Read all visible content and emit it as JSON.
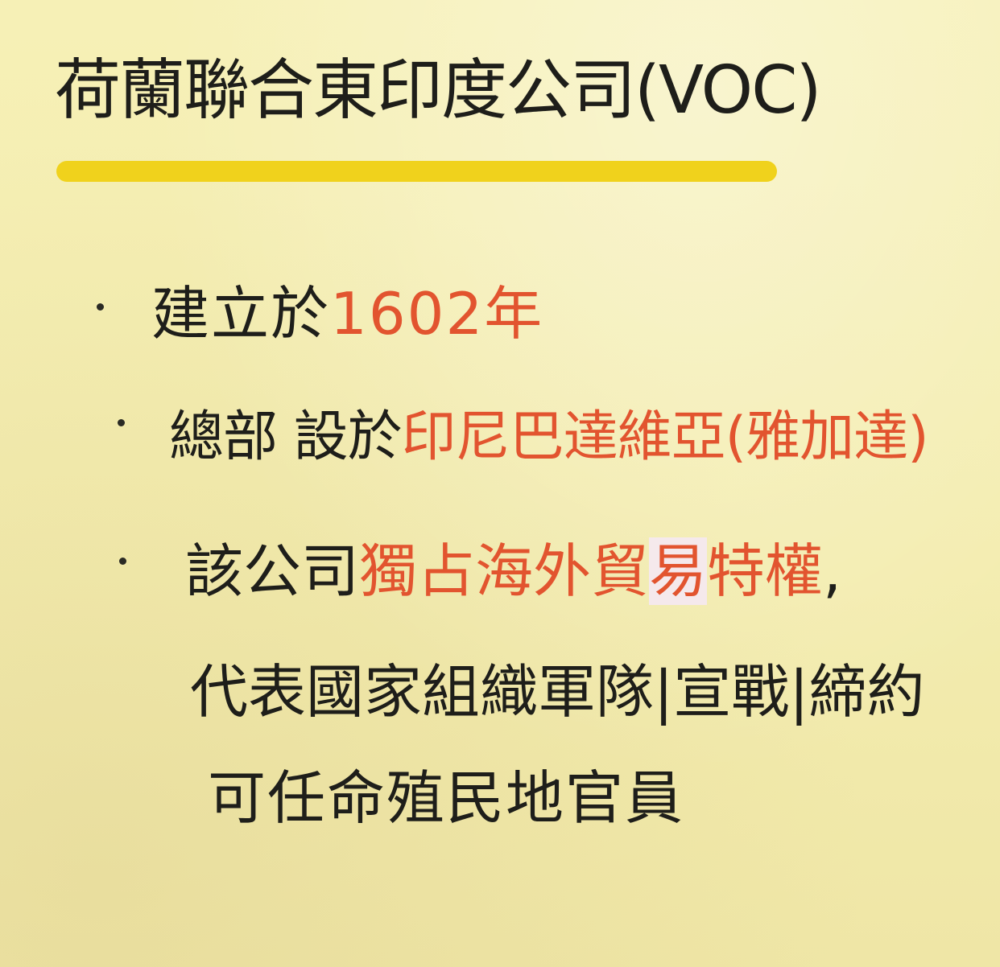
{
  "title": "荷蘭聯合東印度公司(VOC)",
  "colors": {
    "ink": "#1e1e1a",
    "highlight": "#e2542f",
    "underline": "#f0d21c",
    "paper": "#f4eeb0"
  },
  "bullets": [
    {
      "prefix": "建立於",
      "highlight": "1602年"
    },
    {
      "prefix": "總部 設於",
      "highlight": "印尼巴達維亞(雅加達)"
    },
    {
      "prefix": "該公司",
      "highlight_a": "獨占海外貿",
      "highlight_b": "易",
      "highlight_c": "特權",
      "suffix": ","
    }
  ],
  "continuation": [
    "代表國家組織軍隊|宣戰|締約",
    "可任命殖民地官員"
  ]
}
